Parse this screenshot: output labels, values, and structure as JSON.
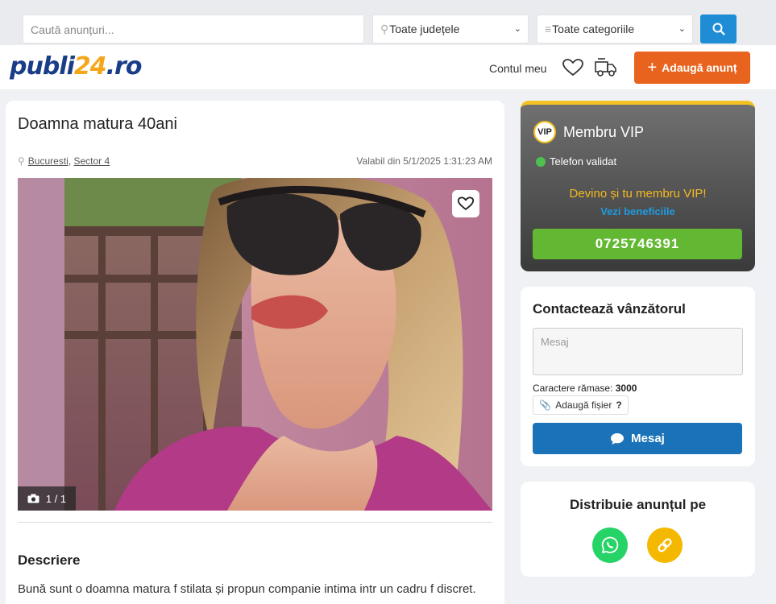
{
  "search": {
    "placeholder": "Caută anunțuri...",
    "county": "Toate județele",
    "category": "Toate categoriile"
  },
  "header": {
    "logo_part1": "publi",
    "logo_part2": "24",
    "logo_part3": ".ro",
    "account": "Contul meu",
    "add_button": "Adaugă anunț",
    "accent_color": "#e8631d"
  },
  "listing": {
    "title": "Doamna matura 40ani",
    "city": "Bucuresti",
    "sector": "Sector 4",
    "valid_from": "Valabil din 5/1/2025 1:31:23 AM",
    "photo_counter": "1 / 1",
    "description_heading": "Descriere",
    "description": "Bună sunt o doamna matura f stilata și propun companie intima intr un cadru f discret."
  },
  "vip": {
    "title": "Membru VIP",
    "badge": "VIP",
    "phone_validated": "Telefon validat",
    "promo": "Devino și tu membru VIP!",
    "benefits_link": "Vezi beneficiile",
    "phone": "0725746391"
  },
  "contact": {
    "heading": "Contactează vânzătorul",
    "message_placeholder": "Mesaj",
    "chars_label": "Caractere rămase:",
    "chars_left": "3000",
    "attach_label": "Adaugă fișier",
    "attach_help": "?",
    "send_button": "Mesaj"
  },
  "share": {
    "heading": "Distribuie anunțul pe"
  }
}
